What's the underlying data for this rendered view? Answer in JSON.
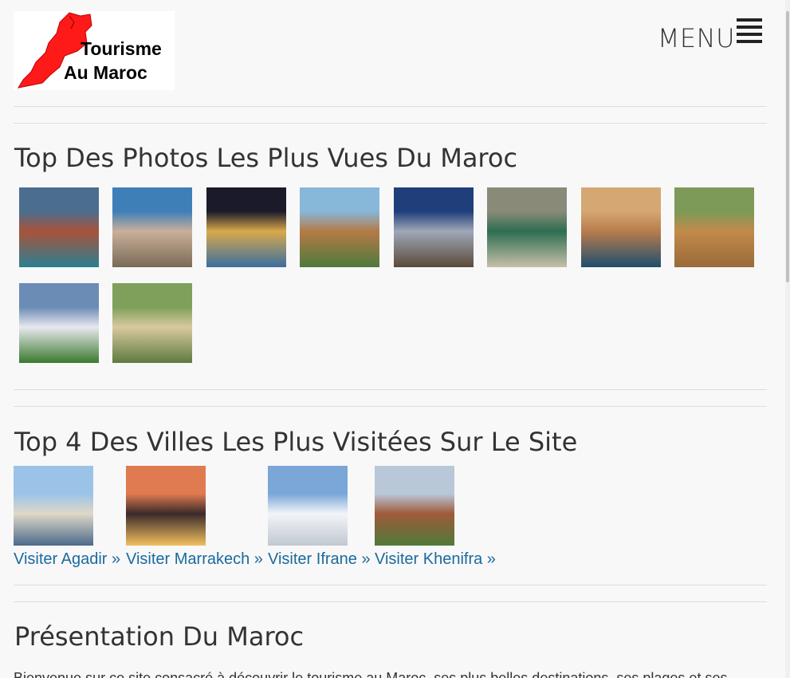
{
  "header": {
    "logo_line1": "Tourisme",
    "logo_line2": "Au Maroc",
    "menu_label": "MENU"
  },
  "top_photos": {
    "title": "Top Des Photos Les Plus Vues Du Maroc",
    "photos": [
      {
        "name": "gorges-canyon-photo",
        "colors": [
          "#4b6e8f",
          "#a8533a",
          "#2a7f93"
        ]
      },
      {
        "name": "agadir-bay-photo",
        "colors": [
          "#3f7fb8",
          "#c9b09a",
          "#7a6a55"
        ]
      },
      {
        "name": "mosque-gate-night-photo",
        "colors": [
          "#1a1a2a",
          "#d9a84a",
          "#3a6fa0"
        ]
      },
      {
        "name": "menara-pavilion-photo",
        "colors": [
          "#87b7d9",
          "#b57a45",
          "#4e7a3d"
        ]
      },
      {
        "name": "fountain-lights-photo",
        "colors": [
          "#1f3e7a",
          "#9fa7b8",
          "#5a4a3a"
        ]
      },
      {
        "name": "rock-pool-photo",
        "colors": [
          "#8a8a78",
          "#2d6e52",
          "#c7c0a8"
        ]
      },
      {
        "name": "desert-coast-photo",
        "colors": [
          "#d5a773",
          "#b87c4c",
          "#1e4e6e"
        ]
      },
      {
        "name": "lion-resting-photo",
        "colors": [
          "#7d9a58",
          "#c28a4a",
          "#9a6a3a"
        ]
      },
      {
        "name": "atlas-mountains-photo",
        "colors": [
          "#6a8cb5",
          "#e8e8ee",
          "#3a7a2e"
        ]
      },
      {
        "name": "lioness-photo",
        "colors": [
          "#7fa05a",
          "#d8c9a0",
          "#5e7a3e"
        ]
      }
    ]
  },
  "top_cities": {
    "title": "Top 4 Des Villes Les Plus Visitées Sur Le Site",
    "cities": [
      {
        "link": "Visiter Agadir »",
        "colors": [
          "#9bc3e8",
          "#e0d8c8",
          "#4b6a8a"
        ]
      },
      {
        "link": "Visiter Marrakech »",
        "colors": [
          "#e07a50",
          "#3a2a2a",
          "#f2c060"
        ]
      },
      {
        "link": "Visiter Ifrane »",
        "colors": [
          "#7aa6d8",
          "#f2f4f8",
          "#c2c8d0"
        ]
      },
      {
        "link": "Visiter Khenifra »",
        "colors": [
          "#b9c8d8",
          "#a05a3a",
          "#4e7a3a"
        ]
      }
    ]
  },
  "presentation": {
    "title": "Présentation Du Maroc",
    "text": "Bienvenue sur ce site consacré à découvrir le tourisme au Maroc, ses plus belles destinations, ses plages et ses villes"
  }
}
